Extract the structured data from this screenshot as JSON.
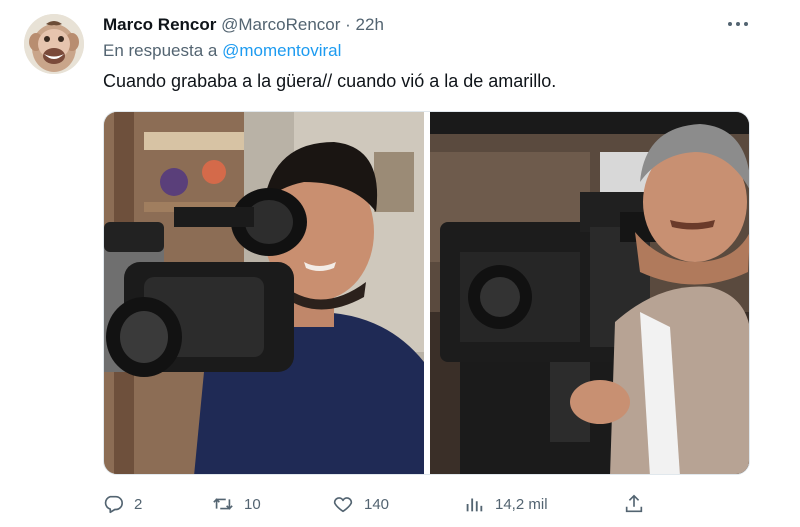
{
  "tweet": {
    "display_name": "Marco Rencor",
    "handle": "@MarcoRencor",
    "separator": "·",
    "time": "22h",
    "more_icon": "more-horizontal-icon",
    "reply_prefix": "En respuesta a",
    "reply_mention": "@momentoviral",
    "text": "Cuando grababa a la güera// cuando vió a la de amarillo."
  },
  "media": {
    "left_image": "man-with-camcorder-photo",
    "right_image": "old-man-with-film-camera-photo"
  },
  "actions": {
    "reply_count": "2",
    "retweet_count": "10",
    "like_count": "140",
    "view_count": "14,2 mil",
    "icons": [
      "reply-icon",
      "retweet-icon",
      "like-icon",
      "views-icon",
      "share-icon"
    ]
  },
  "colors": {
    "accent": "#1d9bf0",
    "secondary_text": "#536471",
    "primary_text": "#0f1419"
  }
}
